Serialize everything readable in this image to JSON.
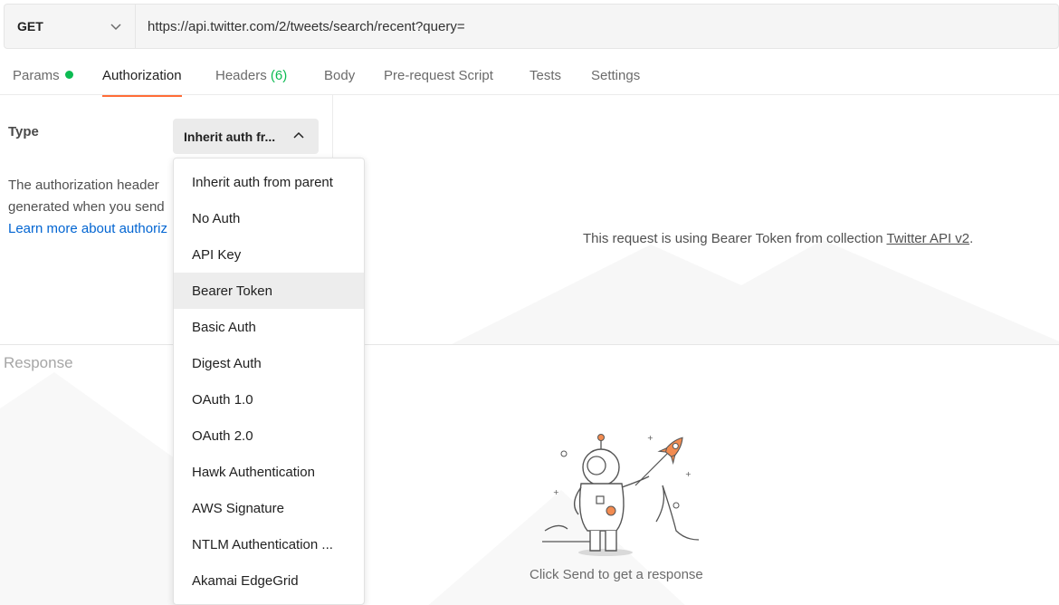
{
  "request": {
    "method": "GET",
    "url": "https://api.twitter.com/2/tweets/search/recent?query="
  },
  "tabs": [
    {
      "label": "Params",
      "has_dot": true
    },
    {
      "label": "Authorization",
      "active": true
    },
    {
      "label": "Headers",
      "count": "(6)"
    },
    {
      "label": "Body"
    },
    {
      "label": "Pre-request Script"
    },
    {
      "label": "Tests"
    },
    {
      "label": "Settings"
    }
  ],
  "auth": {
    "type_label": "Type",
    "selected": "Inherit auth fr...",
    "desc_line1": "The authorization header",
    "desc_line2": "generated when you send",
    "learn_more": "Learn more about authoriz",
    "message_prefix": "This request is using Bearer Token from collection ",
    "collection_link": "Twitter API v2",
    "message_suffix": "."
  },
  "dropdown": {
    "options": [
      "Inherit auth from parent",
      "No Auth",
      "API Key",
      "Bearer Token",
      "Basic Auth",
      "Digest Auth",
      "OAuth 1.0",
      "OAuth 2.0",
      "Hawk Authentication",
      "AWS Signature",
      "NTLM Authentication ...",
      "Akamai EdgeGrid"
    ],
    "highlighted": "Bearer Token"
  },
  "response": {
    "title": "Response",
    "hint": "Click Send to get a response"
  },
  "colors": {
    "accent": "#ff6c37",
    "success": "#0cbb52",
    "link": "#0265d2"
  },
  "icons": {
    "method_chevron": "chevron-down-icon",
    "type_chevron": "chevron-up-icon",
    "illustration": "astronaut-rocket-illustration"
  }
}
